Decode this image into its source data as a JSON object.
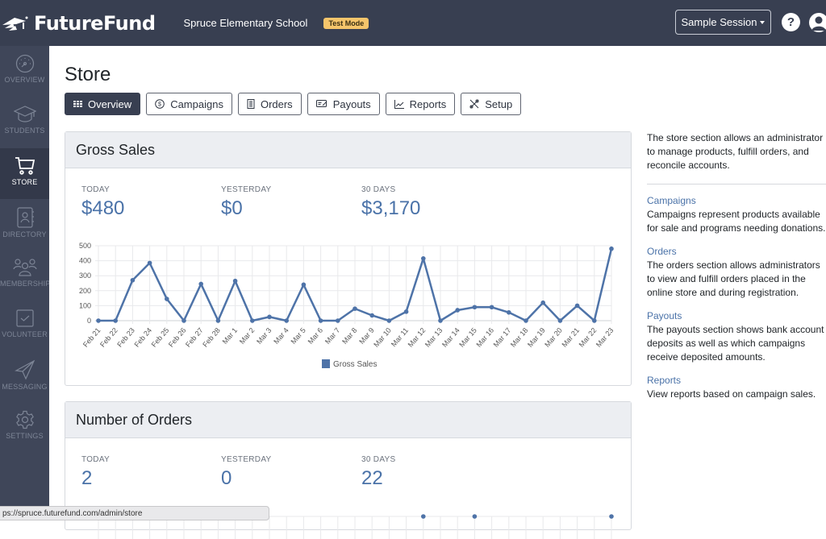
{
  "header": {
    "app_name": "FutureFund",
    "school": "Spruce Elementary School",
    "mode_badge": "Test Mode",
    "session_label": "Sample Session",
    "help_icon": "question-circle-icon",
    "user_icon": "user-circle-icon"
  },
  "sidebar": {
    "items": [
      {
        "label": "OVERVIEW",
        "icon": "dashboard-gauge-icon",
        "active": false
      },
      {
        "label": "STUDENTS",
        "icon": "graduation-cap-icon",
        "active": false
      },
      {
        "label": "STORE",
        "icon": "shopping-cart-icon",
        "active": true
      },
      {
        "label": "DIRECTORY",
        "icon": "address-book-icon",
        "active": false
      },
      {
        "label": "MEMBERSHIP",
        "icon": "users-group-icon",
        "active": false
      },
      {
        "label": "VOLUNTEER",
        "icon": "checkbox-icon",
        "active": false
      },
      {
        "label": "MESSAGING",
        "icon": "paper-plane-icon",
        "active": false
      },
      {
        "label": "SETTINGS",
        "icon": "gear-icon",
        "active": false
      }
    ]
  },
  "page": {
    "title": "Store",
    "tabs": [
      {
        "label": "Overview",
        "icon": "grid-icon",
        "active": true
      },
      {
        "label": "Campaigns",
        "icon": "dollar-circle-icon",
        "active": false
      },
      {
        "label": "Orders",
        "icon": "receipt-icon",
        "active": false
      },
      {
        "label": "Payouts",
        "icon": "bank-check-icon",
        "active": false
      },
      {
        "label": "Reports",
        "icon": "line-chart-icon",
        "active": false
      },
      {
        "label": "Setup",
        "icon": "tools-icon",
        "active": false
      }
    ]
  },
  "gross_sales": {
    "title": "Gross Sales",
    "stats": [
      {
        "label": "TODAY",
        "value": "$480"
      },
      {
        "label": "YESTERDAY",
        "value": "$0"
      },
      {
        "label": "30 DAYS",
        "value": "$3,170"
      }
    ]
  },
  "orders_card": {
    "title": "Number of Orders",
    "stats": [
      {
        "label": "TODAY",
        "value": "2"
      },
      {
        "label": "YESTERDAY",
        "value": "0"
      },
      {
        "label": "30 DAYS",
        "value": "22"
      }
    ]
  },
  "chart_data": {
    "type": "line",
    "title": "",
    "xlabel": "",
    "ylabel": "",
    "ylim": [
      0,
      500
    ],
    "yticks": [
      0,
      100,
      200,
      300,
      400,
      500
    ],
    "grid": true,
    "legend_position": "bottom",
    "color": "#4e73a8",
    "categories": [
      "Feb 21",
      "Feb 22",
      "Feb 23",
      "Feb 24",
      "Feb 25",
      "Feb 26",
      "Feb 27",
      "Feb 28",
      "Mar 1",
      "Mar 2",
      "Mar 3",
      "Mar 4",
      "Mar 5",
      "Mar 6",
      "Mar 7",
      "Mar 8",
      "Mar 9",
      "Mar 10",
      "Mar 11",
      "Mar 12",
      "Mar 13",
      "Mar 14",
      "Mar 15",
      "Mar 16",
      "Mar 17",
      "Mar 18",
      "Mar 19",
      "Mar 20",
      "Mar 21",
      "Mar 22",
      "Mar 23"
    ],
    "series": [
      {
        "name": "Gross Sales",
        "values": [
          0,
          0,
          270,
          385,
          145,
          0,
          245,
          0,
          265,
          0,
          25,
          0,
          240,
          0,
          0,
          80,
          35,
          0,
          60,
          415,
          0,
          70,
          90,
          90,
          55,
          0,
          120,
          0,
          100,
          0,
          480
        ]
      }
    ]
  },
  "aside": {
    "intro": "The store section allows an administrator to manage products, fulfill orders, and reconcile accounts.",
    "sections": [
      {
        "link": "Campaigns",
        "text": "Campaigns represent products available for sale and programs needing donations."
      },
      {
        "link": "Orders",
        "text": "The orders section allows administrators to view and fulfill orders placed in the online store and during registration."
      },
      {
        "link": "Payouts",
        "text": "The payouts section shows bank account deposits as well as which campaigns receive deposited amounts."
      },
      {
        "link": "Reports",
        "text": "View reports based on campaign sales."
      }
    ]
  },
  "status_bar": {
    "url": "ps://spruce.futurefund.com/admin/store"
  }
}
